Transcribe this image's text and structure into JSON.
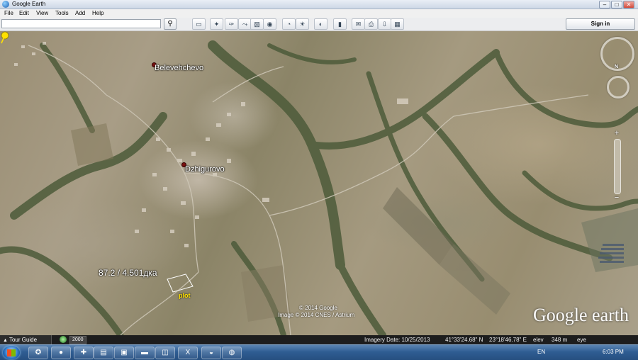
{
  "window": {
    "title": "Google Earth",
    "minimize": "–",
    "maximize": "□",
    "close": "✕"
  },
  "menu": [
    "File",
    "Edit",
    "View",
    "Tools",
    "Add",
    "Help"
  ],
  "toolbar": {
    "search_value": "",
    "search_icon": "search-icon",
    "sign_in": "Sign in",
    "buttons": [
      {
        "name": "sidebar-icon",
        "glyph": "▭"
      },
      {
        "name": "add-placemark-icon",
        "glyph": "✦"
      },
      {
        "name": "add-polygon-icon",
        "glyph": "✑"
      },
      {
        "name": "add-path-icon",
        "glyph": "⤳"
      },
      {
        "name": "add-image-overlay-icon",
        "glyph": "▧"
      },
      {
        "name": "record-tour-icon",
        "glyph": "◉"
      },
      {
        "name": "historical-imagery-icon",
        "glyph": "◔"
      },
      {
        "name": "sunlight-icon",
        "glyph": "☀"
      },
      {
        "name": "planets-icon",
        "glyph": "◐"
      },
      {
        "name": "ruler-icon",
        "glyph": "▮"
      },
      {
        "name": "email-icon",
        "glyph": "✉"
      },
      {
        "name": "print-icon",
        "glyph": "⎙"
      },
      {
        "name": "save-image-icon",
        "glyph": "⇩"
      },
      {
        "name": "view-in-maps-icon",
        "glyph": "▦"
      }
    ]
  },
  "map": {
    "places": [
      {
        "label": "Belevehchevo"
      },
      {
        "label": "Dzhigurovo"
      }
    ],
    "measurement": "87.2 / 4.501дка",
    "plot_label": "plot",
    "copyright_1": "© 2014 Google",
    "copyright_2": "Image © 2014 CNES / Astrium",
    "logo_word1": "Google",
    "logo_word2": "earth",
    "north": "N",
    "zoom_plus": "+",
    "zoom_minus": "−"
  },
  "status": {
    "tour_guide": "Tour Guide",
    "year": "2000",
    "imagery_date": "Imagery Date: 10/25/2013",
    "lat": "41°33'24.68\" N",
    "lon": "23°18'46.78\" E",
    "elev_label": "elev",
    "elev_value": "348 m",
    "eye_label": "eye"
  },
  "taskbar": {
    "apps": [
      {
        "name": "acrobat-icon",
        "glyph": "✪"
      },
      {
        "name": "firefox-icon",
        "glyph": "●"
      },
      {
        "name": "language-flag-icon",
        "glyph": "✚"
      },
      {
        "name": "notepad-icon",
        "glyph": "▤"
      },
      {
        "name": "explorer-icon",
        "glyph": "▣"
      },
      {
        "name": "folder-icon",
        "glyph": "▬"
      },
      {
        "name": "window-icon",
        "glyph": "◫"
      },
      {
        "name": "excel-icon",
        "glyph": "X"
      },
      {
        "name": "network-icon",
        "glyph": "◒"
      },
      {
        "name": "google-earth-icon",
        "glyph": "◍"
      }
    ],
    "language": "EN",
    "time": "6:03 PM"
  },
  "colors": {
    "plot_label": "#ffe100",
    "place_dot": "#7a1010",
    "taskbar": "#2f5d93"
  }
}
